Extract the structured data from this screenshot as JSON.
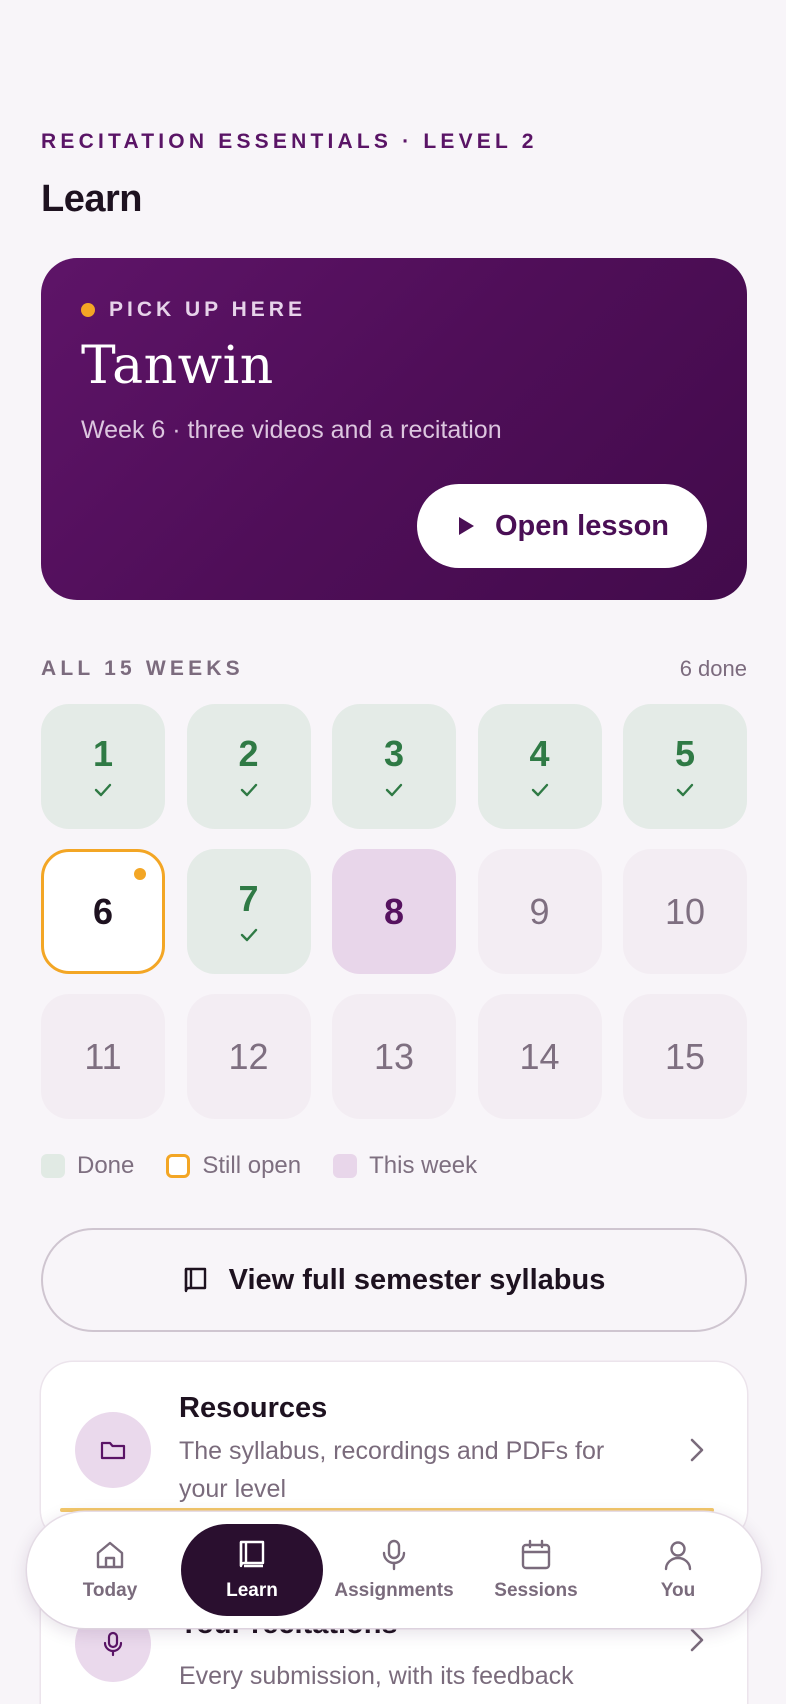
{
  "header": {
    "eyebrow": "RECITATION ESSENTIALS · LEVEL 2",
    "title": "Learn"
  },
  "hero": {
    "kicker": "PICK UP HERE",
    "title": "Tanwin",
    "subtitle": "Week 6 · three videos and a recitation",
    "button_label": "Open lesson",
    "accent_color": "#f3a625"
  },
  "weeks": {
    "label": "ALL 15 WEEKS",
    "done_count": "6 done",
    "items": [
      {
        "number": "1",
        "status": "done"
      },
      {
        "number": "2",
        "status": "done"
      },
      {
        "number": "3",
        "status": "done"
      },
      {
        "number": "4",
        "status": "done"
      },
      {
        "number": "5",
        "status": "done"
      },
      {
        "number": "6",
        "status": "open"
      },
      {
        "number": "7",
        "status": "done"
      },
      {
        "number": "8",
        "status": "current"
      },
      {
        "number": "9",
        "status": "upcoming"
      },
      {
        "number": "10",
        "status": "upcoming"
      },
      {
        "number": "11",
        "status": "upcoming"
      },
      {
        "number": "12",
        "status": "upcoming"
      },
      {
        "number": "13",
        "status": "upcoming"
      },
      {
        "number": "14",
        "status": "upcoming"
      },
      {
        "number": "15",
        "status": "upcoming"
      }
    ]
  },
  "legend": {
    "done": "Done",
    "open": "Still open",
    "current": "This week"
  },
  "syllabus_button": "View full semester syllabus",
  "cards": {
    "resources": {
      "title": "Resources",
      "subtitle": "The syllabus, recordings and PDFs for your level",
      "icon": "folder-icon"
    },
    "recitations": {
      "title": "Your recitations",
      "subtitle": "Every submission, with its feedback",
      "icon": "microphone-icon"
    }
  },
  "nav": {
    "items": [
      {
        "label": "Today",
        "icon": "home-icon"
      },
      {
        "label": "Learn",
        "icon": "book-icon",
        "active": true
      },
      {
        "label": "Assignments",
        "icon": "microphone-icon"
      },
      {
        "label": "Sessions",
        "icon": "calendar-icon"
      },
      {
        "label": "You",
        "icon": "user-icon"
      }
    ]
  },
  "colors": {
    "brand": "#5a1466",
    "done_green": "#2f7a45",
    "open_amber": "#f3a625",
    "nav_active": "#2a0f2f"
  }
}
